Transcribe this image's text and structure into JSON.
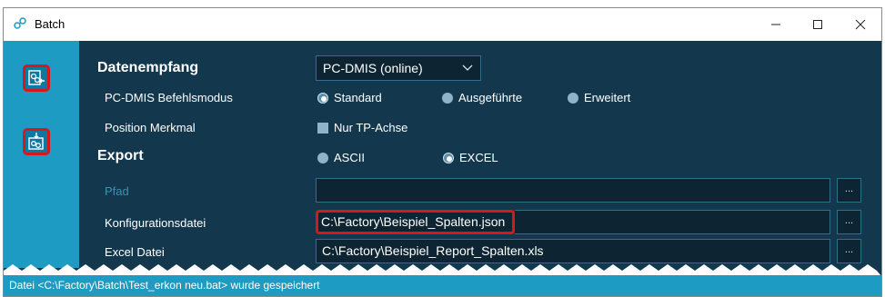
{
  "window": {
    "title": "Batch",
    "icon": "gear-link-icon"
  },
  "rail": {
    "buttons": [
      {
        "name": "receive-config-button",
        "icon": "gear-in-icon",
        "selected": true
      },
      {
        "name": "export-config-button",
        "icon": "gear-out-icon",
        "selected": false
      }
    ]
  },
  "datenempfang": {
    "heading": "Datenempfang",
    "source": "PC-DMIS (online)",
    "befehlsmodus_label": "PC-DMIS Befehlsmodus",
    "modes": [
      {
        "label": "Standard",
        "selected": true
      },
      {
        "label": "Ausgeführte",
        "selected": false
      },
      {
        "label": "Erweitert",
        "selected": false
      }
    ],
    "position_label": "Position Merkmal",
    "nur_tp": {
      "label": "Nur TP-Achse",
      "checked": false
    }
  },
  "export": {
    "heading": "Export",
    "formats": [
      {
        "label": "ASCII",
        "selected": false
      },
      {
        "label": "EXCEL",
        "selected": true
      }
    ],
    "pfad_label": "Pfad",
    "pfad_value": "",
    "konfig_label": "Konfigurationsdatei",
    "konfig_value": "C:\\Factory\\Beispiel_Spalten.json",
    "excel_label": "Excel Datei",
    "excel_value": "C:\\Factory\\Beispiel_Report_Spalten.xls",
    "browse_label": "..."
  },
  "status": {
    "text": "Datei <C:\\Factory\\Batch\\Test_erkon neu.bat> wurde gespeichert"
  },
  "colors": {
    "rail": "#1d9bc2",
    "content_bg": "#13384d",
    "highlight": "#d4181c"
  }
}
